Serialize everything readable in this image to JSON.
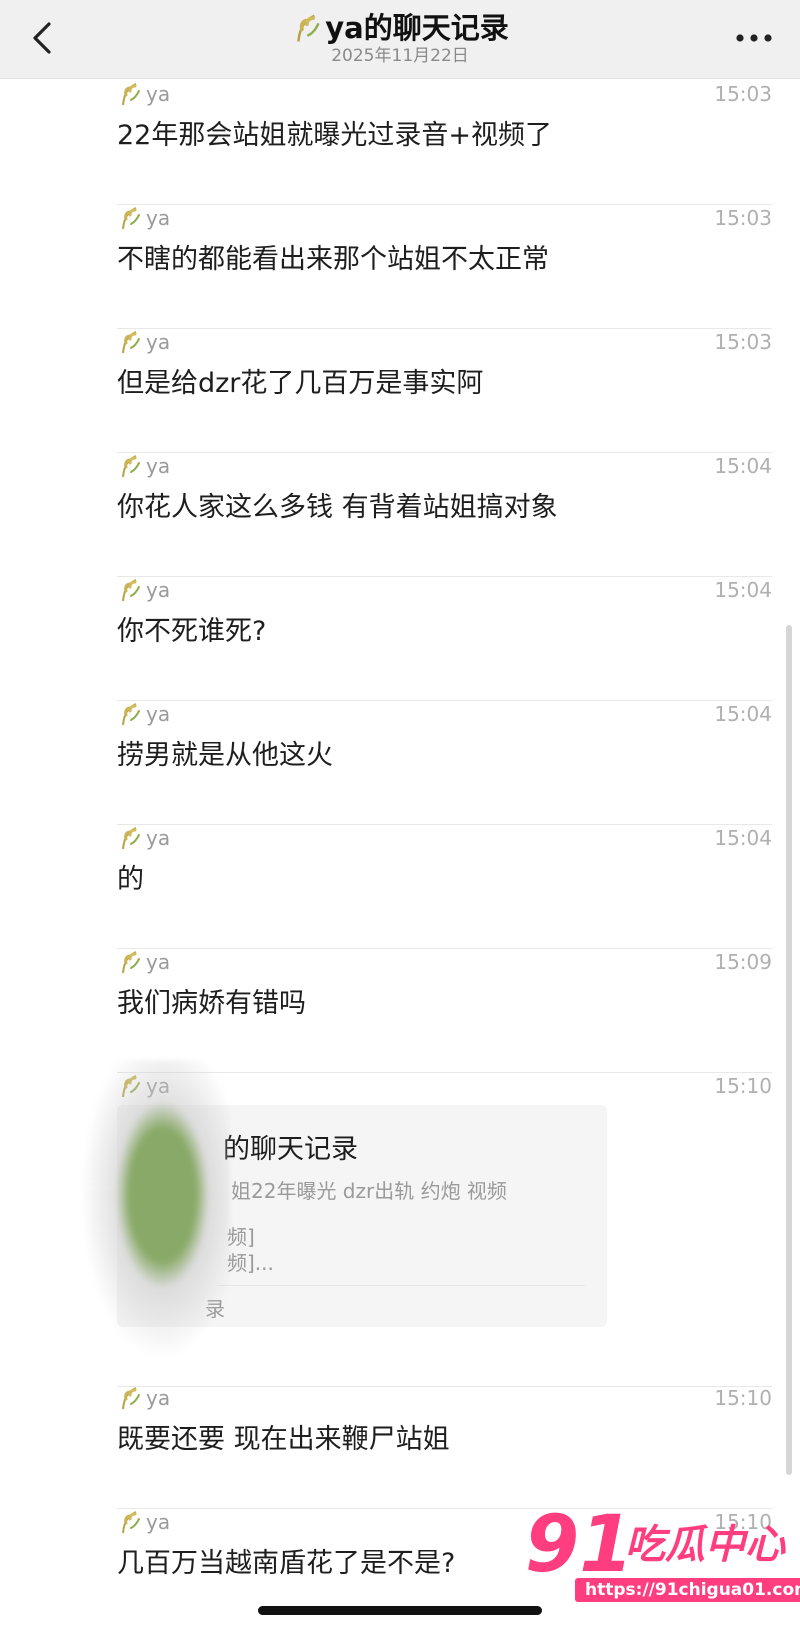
{
  "header": {
    "title": "ya的聊天记录",
    "date": "2025年11月22日"
  },
  "messages": [
    {
      "sender": "ya",
      "time": "15:03",
      "text": "22年那会站姐就曝光过录音+视频了"
    },
    {
      "sender": "ya",
      "time": "15:03",
      "text": "不瞎的都能看出来那个站姐不太正常"
    },
    {
      "sender": "ya",
      "time": "15:03",
      "text": "但是给dzr花了几百万是事实阿"
    },
    {
      "sender": "ya",
      "time": "15:04",
      "text": "你花人家这么多钱 有背着站姐搞对象"
    },
    {
      "sender": "ya",
      "time": "15:04",
      "text": "你不死谁死?"
    },
    {
      "sender": "ya",
      "time": "15:04",
      "text": "捞男就是从他这火"
    },
    {
      "sender": "ya",
      "time": "15:04",
      "text": "的"
    },
    {
      "sender": "ya",
      "time": "15:09",
      "text": "我们病娇有错吗"
    }
  ],
  "forward": {
    "sender": "ya",
    "time": "15:10",
    "title": "的聊天记录",
    "line1": "姐22年曝光 dzr出轨 约炮 视频",
    "line2": "频]",
    "line3": "频]...",
    "footer": "录"
  },
  "messages_after": [
    {
      "sender": "ya",
      "time": "15:10",
      "text": "既要还要 现在出来鞭尸站姐"
    },
    {
      "sender": "ya",
      "time": "15:10",
      "text": "几百万当越南盾花了是不是?"
    }
  ],
  "watermark": {
    "num": "91",
    "cn": "吃瓜中心",
    "url": "https://91chigua01.com"
  },
  "icons": {
    "back": "chevron-left-icon",
    "more": "more-horizontal-icon",
    "avatar": "wheat-icon"
  },
  "colors": {
    "header_bg": "#f0f0f0",
    "wheat": "#b7a24a",
    "watermark": "#ff3d7f"
  }
}
